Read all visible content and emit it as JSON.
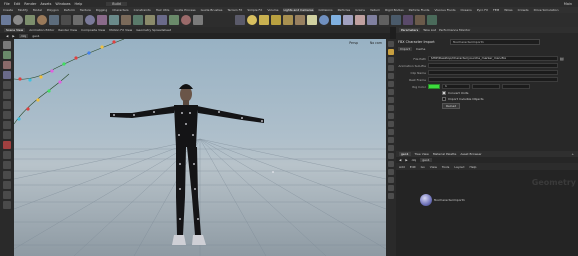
{
  "menubar": {
    "items": [
      "File",
      "Edit",
      "Render",
      "Assets",
      "Windows",
      "Help"
    ],
    "desktop": "Build",
    "right": "Main"
  },
  "shelf": {
    "tabs": [
      "Create",
      "Modify",
      "Model",
      "Polygon",
      "Deform",
      "Texture",
      "Rigging",
      "Characters",
      "Constraints",
      "Hair Utils",
      "Guide Process",
      "Guide Brushes",
      "Terrain FX",
      "Simple FX",
      "Volume",
      "Lights and Cameras",
      "Collisions",
      "Particles",
      "Grains",
      "Vellum",
      "Rigid Bodies",
      "Particle Fluids",
      "Viscous Fluids",
      "Oceans",
      "Pyro FX",
      "FEM",
      "Wires",
      "Crowds",
      "Drive Simulation"
    ],
    "active": "Lights and Cameras"
  },
  "scene_tabs": [
    "Scene View",
    "Animation Editor",
    "Render View",
    "Composite View",
    "Motion FX View",
    "Geometry Spreadsheet"
  ],
  "viewport": {
    "path": "/obj",
    "node": "geo1",
    "view_label": "Persp",
    "camera_label": "No cam"
  },
  "parameters": {
    "tabs_header": [
      "Parameters",
      "Take List",
      "Performance Monitor"
    ],
    "node_type": "FBX Character Import",
    "node_name": "fbxcharacterimport1",
    "tabs": [
      "Import",
      "Cache"
    ],
    "fields": [
      {
        "label": "File Path",
        "value": "$HIP/Desktop/Character/yourche_marker_man.fbx"
      },
      {
        "label": "Animation Sub-file",
        "value": ""
      },
      {
        "label": "Clip Name",
        "value": ""
      },
      {
        "label": "Rest Frame",
        "value": ""
      },
      {
        "label": "Rig Color",
        "value": "1"
      }
    ],
    "checks": [
      "Convert Units",
      "Import Invisible Objects",
      "Reload"
    ]
  },
  "network": {
    "tabs": [
      "geo1",
      "Tree View",
      "Material Palette",
      "Asset Browser"
    ],
    "active_tab": "geo1",
    "path": [
      "obj",
      "geo1"
    ],
    "menu": [
      "Add",
      "Edit",
      "Go",
      "View",
      "Tools",
      "Layout",
      "Help"
    ],
    "context_label": "Geometry",
    "node_label": "fbxcharacterimport1"
  },
  "colors": {
    "accent": "#f4c64a",
    "rig_color": "#3ddc3d",
    "node": "#6e72b8"
  }
}
